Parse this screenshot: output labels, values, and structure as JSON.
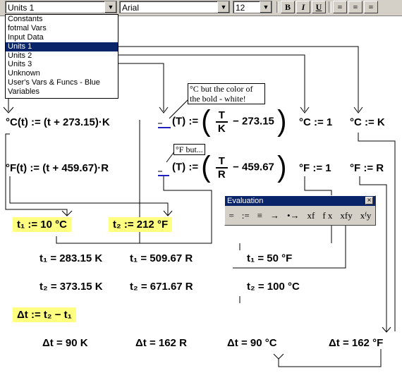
{
  "toolbar": {
    "style_combo": "Units 1",
    "font_combo": "Arial",
    "size_combo": "12",
    "bold_label": "B",
    "italic_label": "I",
    "underline_label": "U"
  },
  "style_list": [
    "Constants",
    "fotmal Vars",
    "Input Data",
    "Units 1",
    "Units 2",
    "Units 3",
    "Unknown",
    "User's Vars & Funcs - Blue",
    "Variables"
  ],
  "notes": {
    "celsius_note": "°C but the color of the bold - white!",
    "fahrenheit_note": "°F but..."
  },
  "eq": {
    "c_def": "°C(t) := (t + 273.15)·K",
    "f_def": "°F(t) := (t + 459.67)·R",
    "c_inv_lhs": "(T) :=",
    "c_inv_num": "T",
    "c_inv_den": "K",
    "c_inv_tail": "− 273.15",
    "f_inv_lhs": "(T) :=",
    "f_inv_num": "T",
    "f_inv_den": "R",
    "f_inv_tail": "− 459.67",
    "c_unit": "°C := 1",
    "c_unit_k": "°C := K",
    "f_unit": "°F := 1",
    "f_unit_r": "°F := R",
    "t1_assign": "t₁ := 10 °C",
    "t2_assign": "t₂ := 212 °F",
    "t1_k": "t₁ = 283.15 K",
    "t1_r": "t₁ = 509.67 R",
    "t1_f": "t₁ = 50 °F",
    "t2_k": "t₂ = 373.15 K",
    "t2_r": "t₂ = 671.67 R",
    "t2_c": "t₂ = 100 °C",
    "dt_assign": "Δt := t₂ − t₁",
    "dt_k": "Δt = 90 K",
    "dt_r": "Δt = 162 R",
    "dt_c": "Δt = 90 °C",
    "dt_f": "Δt = 162 °F"
  },
  "evaluation": {
    "title": "Evaluation",
    "buttons": [
      "=",
      ":=",
      "≡",
      "→",
      "•→",
      "xf",
      "f x",
      "xfy",
      "xᶠy"
    ]
  }
}
